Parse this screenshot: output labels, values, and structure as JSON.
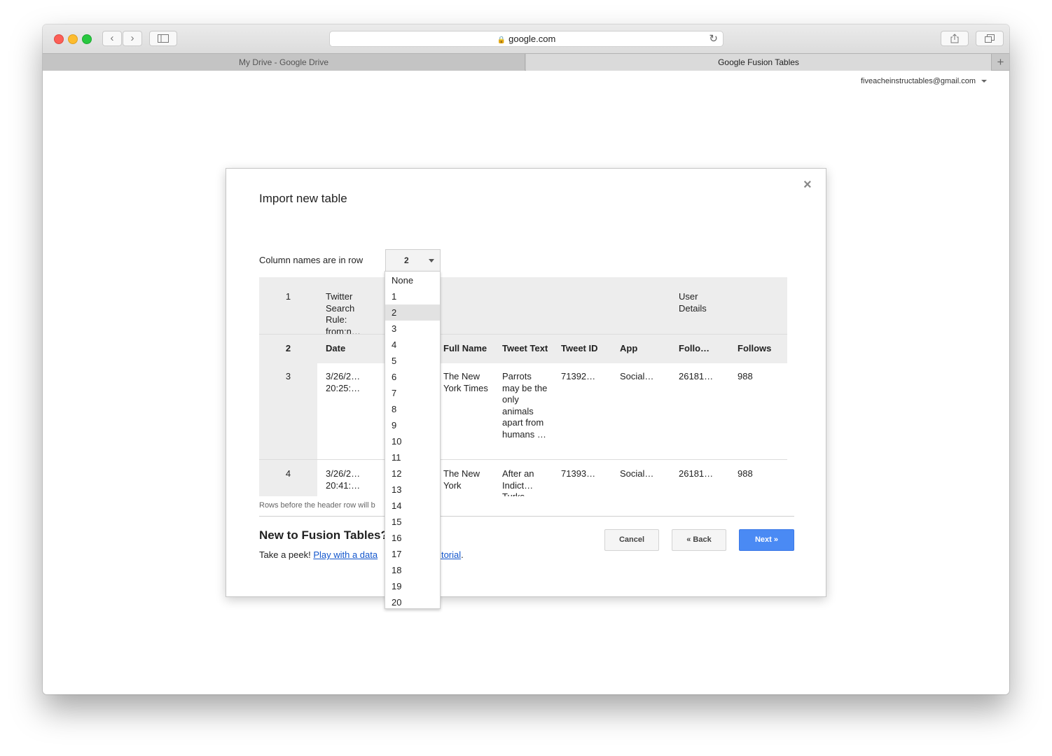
{
  "browser": {
    "url": "google.com",
    "tabs": [
      {
        "label": "My Drive - Google Drive"
      },
      {
        "label": "Google Fusion Tables"
      }
    ]
  },
  "account": {
    "email": "fiveacheinstructables@gmail.com"
  },
  "dialog": {
    "title": "Import new table",
    "close": "×",
    "column_names_label": "Column names are in row",
    "selected_row": "2",
    "options": [
      "None",
      "1",
      "2",
      "3",
      "4",
      "5",
      "6",
      "7",
      "8",
      "9",
      "10",
      "11",
      "12",
      "13",
      "14",
      "15",
      "16",
      "17",
      "18",
      "19",
      "20"
    ],
    "rows_note": "Rows before the header row will b",
    "new_to": "New to Fusion Tables?",
    "peek_prefix": "Take a peek! ",
    "peek_link_1": "Play with a data",
    "peek_link_2": "tutorial",
    "peek_suffix": ".",
    "buttons": {
      "cancel": "Cancel",
      "back": "« Back",
      "next": "Next »"
    }
  },
  "table": {
    "row1": {
      "num": "1",
      "c1": "Twitter Search Rule: from:n…",
      "c8": "User Details"
    },
    "header": {
      "num": "2",
      "cols": [
        "Date",
        "Full Name",
        "Tweet Text",
        "Tweet ID",
        "App",
        "Follo…",
        "Follows"
      ]
    },
    "rows": [
      {
        "num": "3",
        "cells": [
          "3/26/2… 20:25:…",
          "The New York Times",
          "Parrots may be the only animals apart from humans …",
          "71392…",
          "Social…",
          "26181…",
          "988"
        ]
      },
      {
        "num": "4",
        "cells": [
          "3/26/2… 20:41:…",
          "The New York",
          "After an Indict… Turks",
          "71393…",
          "Social…",
          "26181…",
          "988"
        ]
      }
    ]
  }
}
